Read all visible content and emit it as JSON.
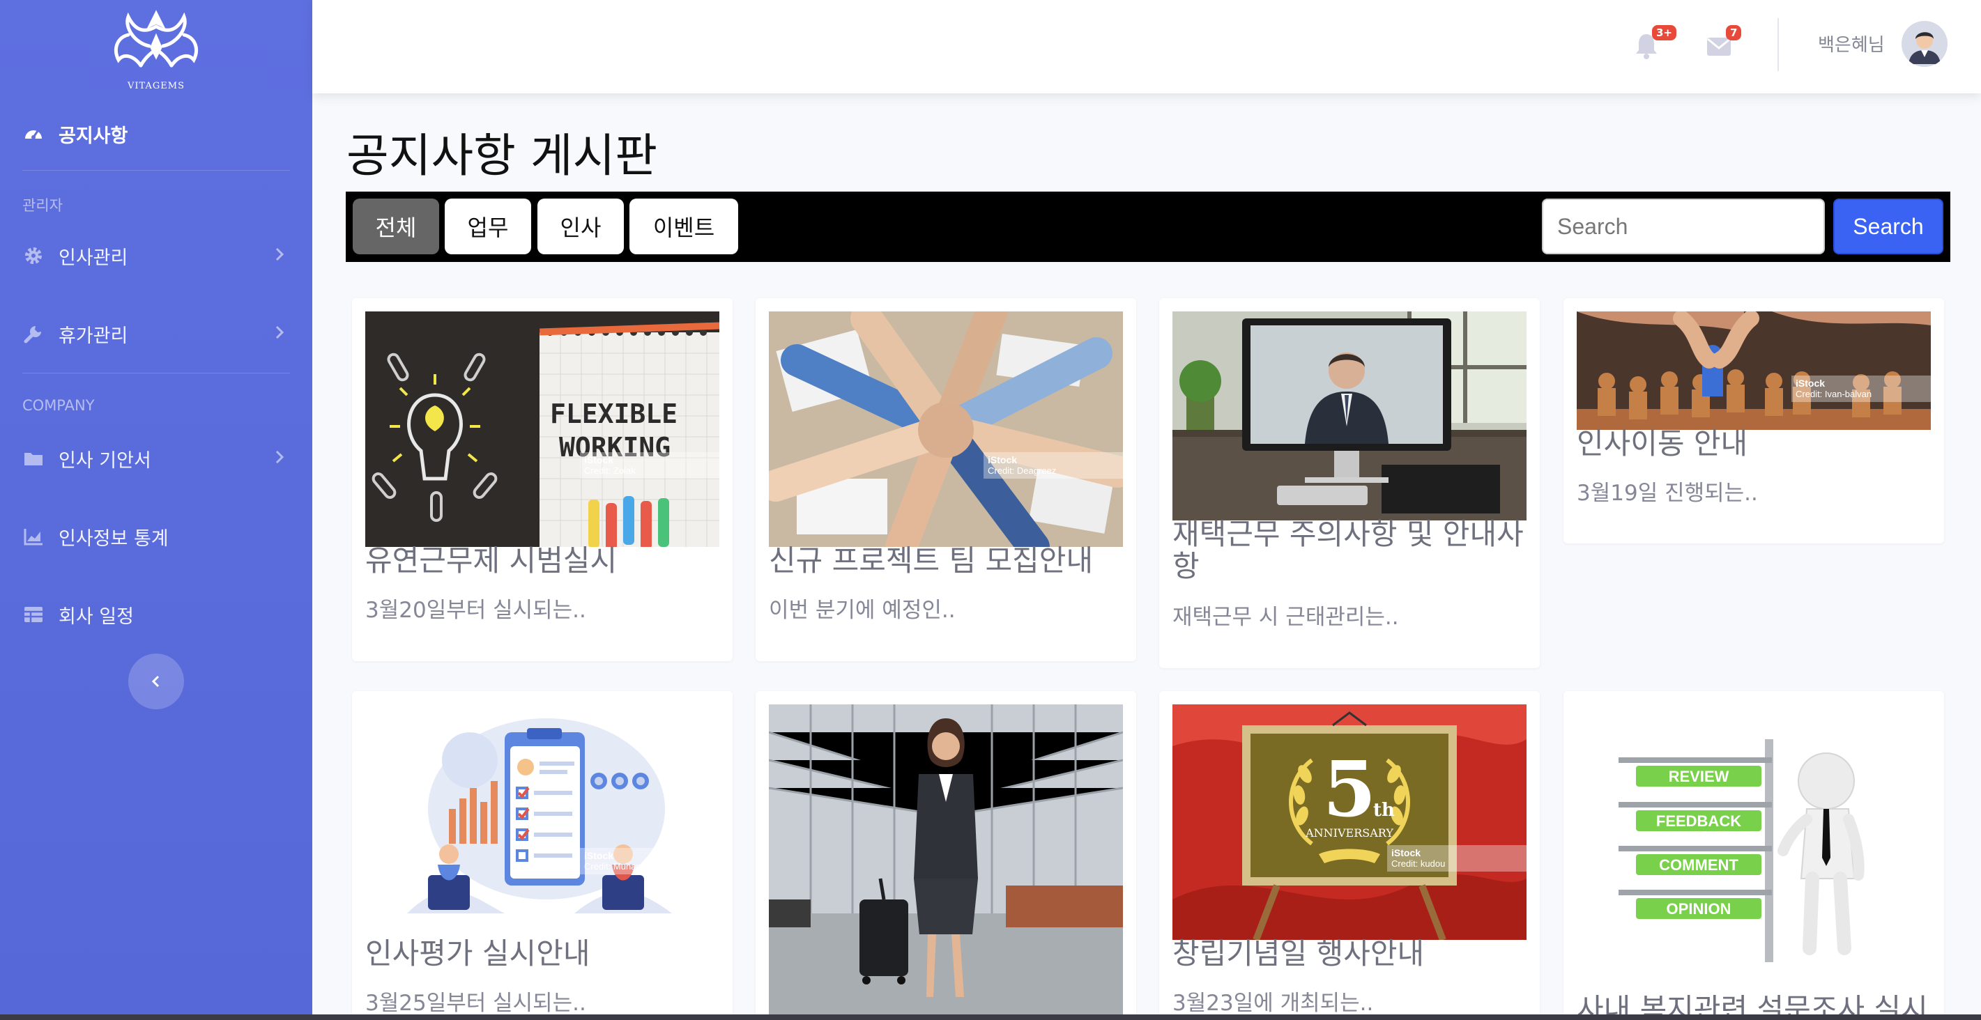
{
  "brand": {
    "name": "VITAGEMS"
  },
  "sidebar": {
    "top_item": {
      "label": "공지사항",
      "icon": "dashboard-icon"
    },
    "section_admin": "관리자",
    "admin_items": [
      {
        "label": "인사관리",
        "icon": "gear-icon"
      },
      {
        "label": "휴가관리",
        "icon": "wrench-icon"
      }
    ],
    "section_company": "COMPANY",
    "company_items": [
      {
        "label": "인사 기안서",
        "icon": "folder-icon"
      },
      {
        "label": "인사정보 통계",
        "icon": "chart-icon"
      },
      {
        "label": "회사 일정",
        "icon": "table-icon"
      }
    ]
  },
  "topbar": {
    "alerts_badge": "3+",
    "messages_badge": "7",
    "user_name": "백은혜님"
  },
  "page": {
    "title": "공지사항 게시판"
  },
  "filters": {
    "categories": [
      "전체",
      "업무",
      "인사",
      "이벤트"
    ],
    "active": "전체",
    "search_placeholder": "Search",
    "search_button": "Search"
  },
  "cards": [
    {
      "title": "유연근무제 시범실시",
      "desc": "3월20일부터 실시되는..",
      "image": "flexible-working-photo",
      "credit": "Credit: Zolak"
    },
    {
      "title": "신규 프로젝트 팀 모집안내",
      "desc": "이번 분기에 예정인..",
      "image": "team-hands-photo",
      "credit": "Credit: Deagreez"
    },
    {
      "title": "재택근무 주의사항 및 안내사항",
      "desc": "재택근무 시 근태관리는..",
      "image": "video-call-photo"
    },
    {
      "title": "인사이동 안내",
      "desc": "3월19일 진행되는..",
      "image": "wooden-figures-photo",
      "credit": "Credit: Ivan-balvan"
    },
    {
      "title": "인사평가 실시안내",
      "desc": "3월25일부터 실시되는..",
      "image": "evaluation-illustration",
      "credit": "Credit: Muhamad Chabib alwi"
    },
    {
      "title": "",
      "desc": "",
      "image": "business-woman-airport-photo"
    },
    {
      "title": "창립기념일 행사안내",
      "desc": "3월23일에 개최되는..",
      "image": "anniversary-photo",
      "credit": "Credit: kudou",
      "anniv_number": "5",
      "anniv_suffix": "th",
      "anniv_text": "ANNIVERSARY"
    },
    {
      "title": "사내 복지관련 설문조사 실시",
      "desc": "",
      "image": "feedback-signpost-illustration",
      "signs": [
        "REVIEW",
        "FEEDBACK",
        "COMMENT",
        "OPINION"
      ]
    }
  ],
  "istock_label": "iStock",
  "colors": {
    "sidebar": "#5e6fe0",
    "search_button": "#3b63f3",
    "badge": "#e74a3b",
    "filter_bar": "#000000"
  }
}
